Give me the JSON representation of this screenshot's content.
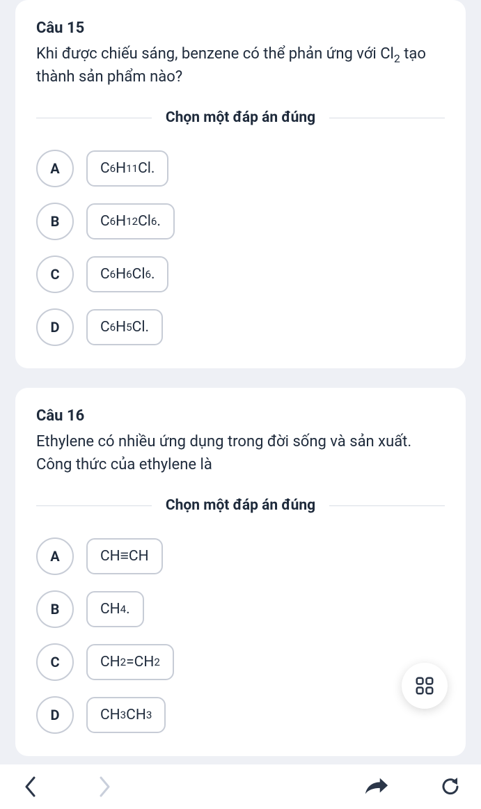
{
  "questions": [
    {
      "title": "Câu 15",
      "text_parts": [
        "Khi được chiếu sáng, benzene có thể phản ứng với Cl",
        "2",
        " tạo thành sản phẩm nào?"
      ],
      "instruction": "Chọn một đáp án đúng",
      "options": [
        {
          "letter": "A",
          "formula": [
            [
              "C",
              "6"
            ],
            [
              "H",
              "11"
            ],
            [
              "Cl",
              ""
            ]
          ],
          "tail": "."
        },
        {
          "letter": "B",
          "formula": [
            [
              "C",
              "6"
            ],
            [
              "H",
              "12"
            ],
            [
              "Cl",
              "6"
            ]
          ],
          "tail": "."
        },
        {
          "letter": "C",
          "formula": [
            [
              "C",
              "6"
            ],
            [
              "H",
              "6"
            ],
            [
              "Cl",
              "6"
            ]
          ],
          "tail": "."
        },
        {
          "letter": "D",
          "formula": [
            [
              "C",
              "6"
            ],
            [
              "H",
              "5"
            ],
            [
              "Cl",
              ""
            ]
          ],
          "tail": "."
        }
      ]
    },
    {
      "title": "Câu 16",
      "text_plain": "Ethylene có nhiều ứng dụng trong đời sống và sản xuất. Công thức của ethylene là",
      "instruction": "Chọn một đáp án đúng",
      "options": [
        {
          "letter": "A",
          "runs": [
            [
              "CH ",
              ""
            ],
            [
              "≡",
              ""
            ],
            [
              "CH",
              ""
            ]
          ]
        },
        {
          "letter": "B",
          "runs": [
            [
              "CH",
              "4"
            ],
            [
              ".",
              ""
            ]
          ]
        },
        {
          "letter": "C",
          "runs": [
            [
              "CH",
              "2"
            ],
            [
              " =CH",
              "2"
            ]
          ]
        },
        {
          "letter": "D",
          "runs": [
            [
              "CH",
              "3"
            ],
            [
              "CH",
              "3"
            ]
          ]
        }
      ]
    }
  ],
  "colors": {
    "icon_active": "#2b3648",
    "icon_disabled": "#c9cfdb"
  }
}
